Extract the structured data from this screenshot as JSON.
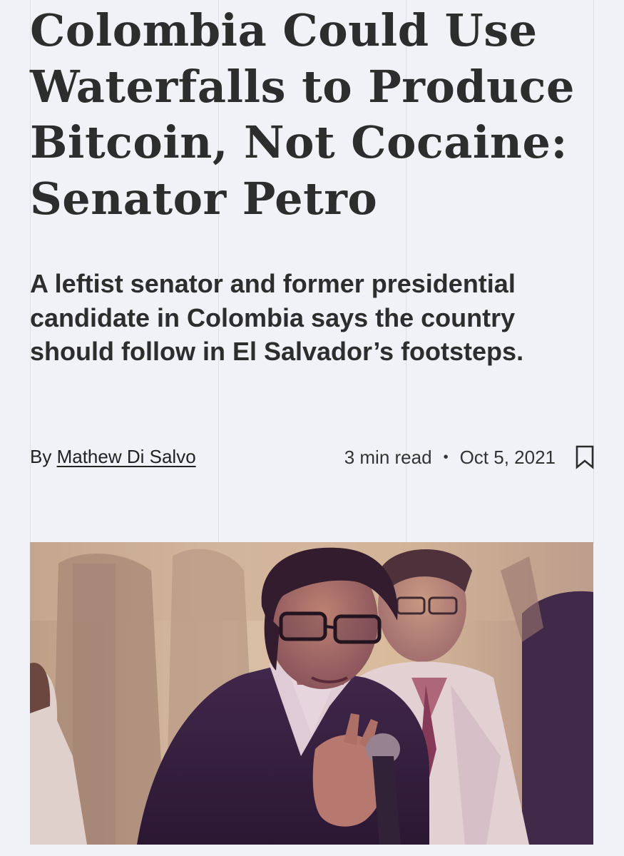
{
  "article": {
    "headline": "Colombia Could Use Waterfalls to Produce Bitcoin, Not Cocaine: Senator Petro",
    "subheadline": "A leftist senator and former presidential candidate in Colombia says the country should follow in El Salvador’s footsteps.",
    "byline_prefix": "By",
    "author": "Mathew Di Salvo",
    "read_time": "3 min read",
    "separator": "•",
    "date": "Oct 5, 2021"
  },
  "icons": {
    "bookmark": "bookmark-icon"
  },
  "colors": {
    "background": "#f1f2f7",
    "text": "#2d2d2d",
    "photo_tint_warm": "#e9cfa3",
    "photo_tint_purple": "#3a1f45"
  }
}
